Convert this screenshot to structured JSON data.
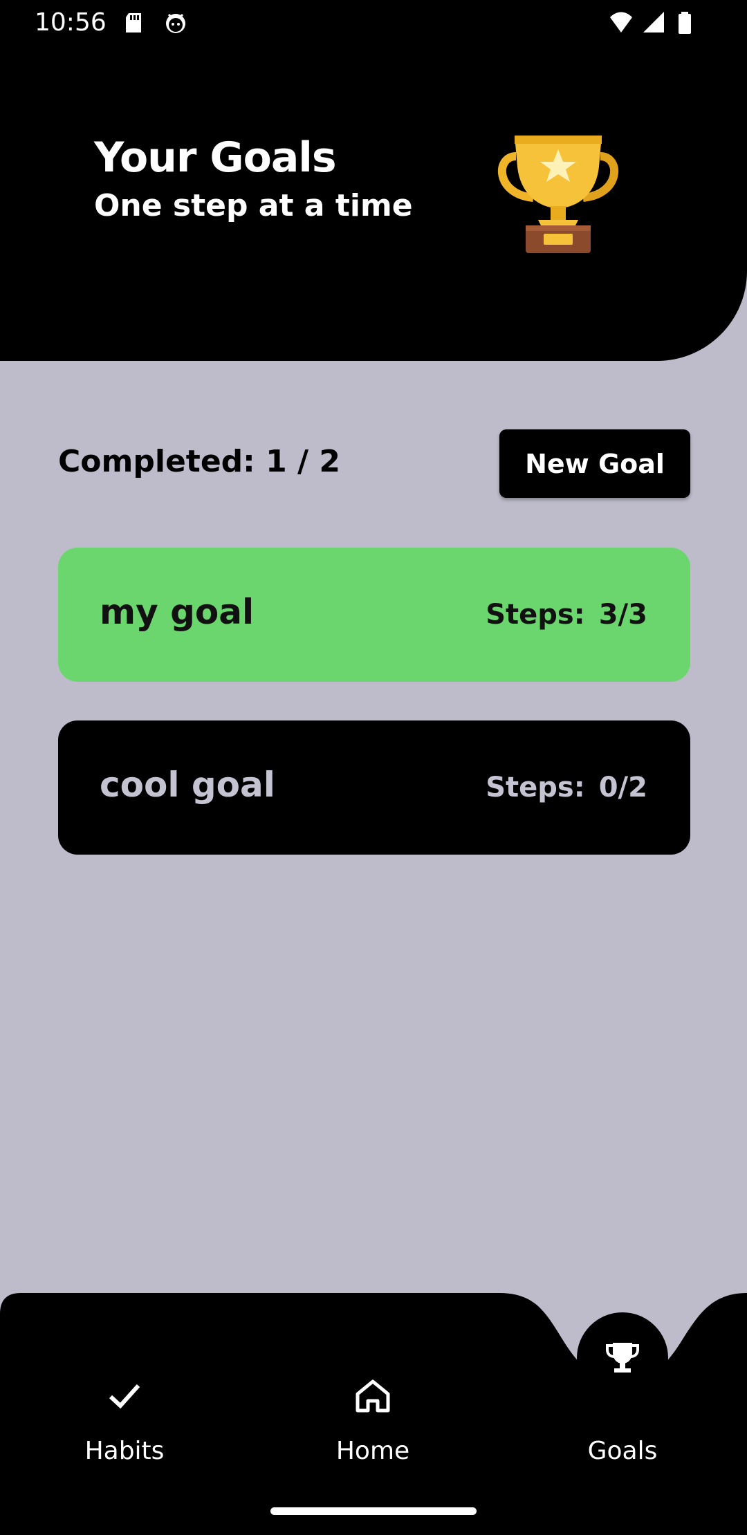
{
  "status_bar": {
    "time": "10:56",
    "icons": [
      "sd-card-icon",
      "android-debug-icon",
      "wifi-icon",
      "signal-icon",
      "battery-icon"
    ]
  },
  "header": {
    "title": "Your Goals",
    "subtitle": "One step at a time",
    "illustration": "trophy-icon"
  },
  "summary": {
    "completed_label": "Completed: 1 / 2",
    "new_goal_label": "New Goal"
  },
  "goals": [
    {
      "name": "my goal",
      "steps_label": "Steps:",
      "steps_value": "3/3",
      "completed": true,
      "background": "#6bd66e",
      "text_color": "#111111"
    },
    {
      "name": "cool goal",
      "steps_label": "Steps:",
      "steps_value": "0/2",
      "completed": false,
      "background": "#000000",
      "text_color": "#c4c3d1"
    }
  ],
  "bottom_nav": {
    "items": [
      {
        "label": "Habits",
        "icon": "check-icon"
      },
      {
        "label": "Home",
        "icon": "home-icon"
      },
      {
        "label": "Goals",
        "icon": "trophy-icon",
        "active": true
      }
    ]
  },
  "colors": {
    "background": "#bebcca",
    "header": "#000000",
    "accent_green": "#6bd66e"
  }
}
